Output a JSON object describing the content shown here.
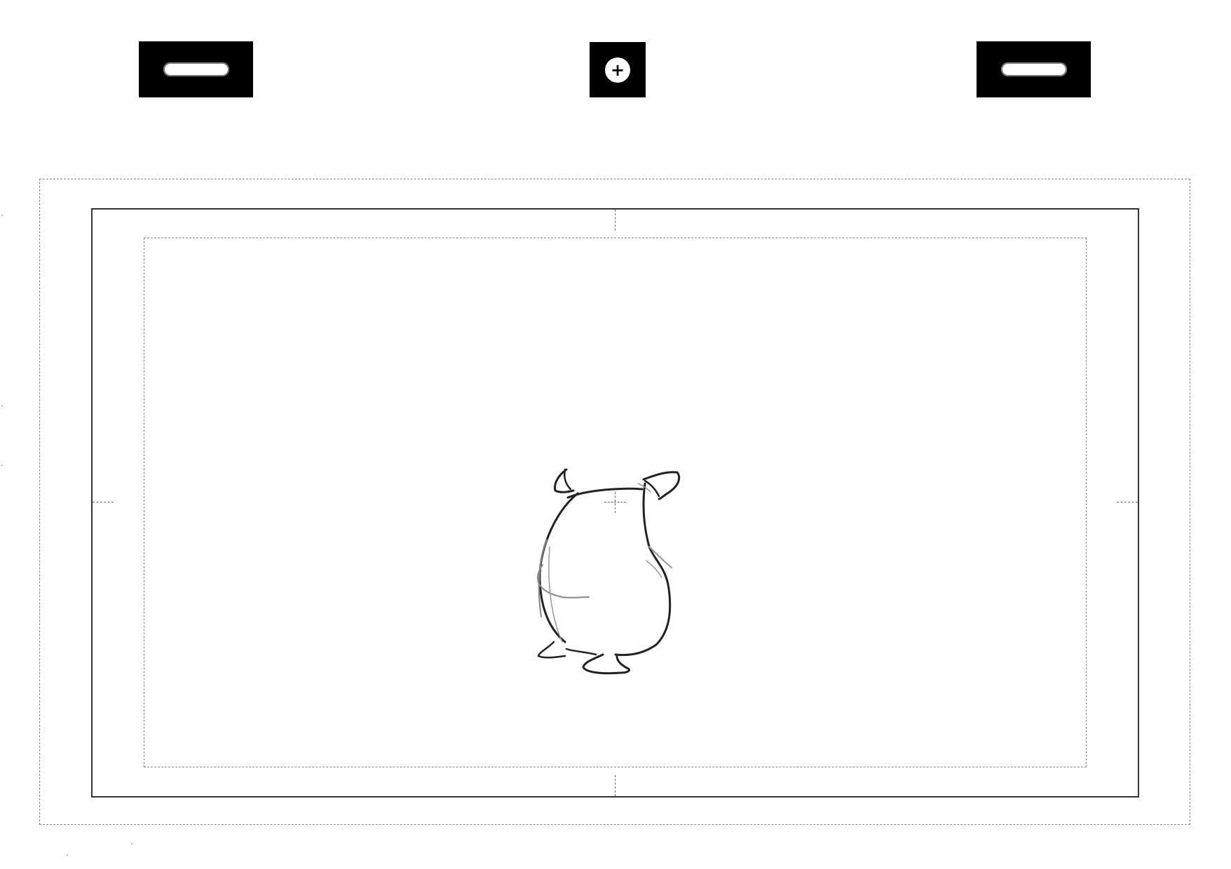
{
  "pegs": {
    "left": {
      "icon": "peg-slot-icon"
    },
    "center": {
      "icon": "peg-round-plus-icon",
      "glyph": "+"
    },
    "right": {
      "icon": "peg-slot-icon"
    }
  },
  "field_guide": {
    "frames": [
      "action-safe",
      "field-frame",
      "title-safe"
    ],
    "center_mark": "crosshair",
    "colors": {
      "frame_line": "#333333",
      "dashed_line": "#888888",
      "sketch_line": "#222222",
      "peg_hole": "#000000"
    }
  },
  "drawing": {
    "icon": "hamster-back-view-sketch"
  }
}
